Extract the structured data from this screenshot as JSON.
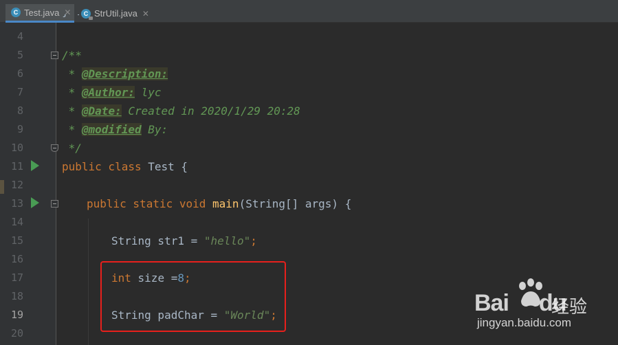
{
  "tabs": [
    {
      "label": "Test.java",
      "icon": "java-class-icon",
      "active": true
    },
    {
      "label": "StrUtil.java",
      "icon": "java-class-locked-icon",
      "active": false
    }
  ],
  "lines": [
    {
      "num": "4",
      "text": ""
    },
    {
      "num": "5",
      "text": "/**"
    },
    {
      "num": "6",
      "prefix": " * ",
      "tag": "@Description:",
      "rest": ""
    },
    {
      "num": "7",
      "prefix": " * ",
      "tag": "@Author:",
      "rest": " lyc"
    },
    {
      "num": "8",
      "prefix": " * ",
      "tag": "@Date:",
      "rest": " Created in 2020/1/29 20:28"
    },
    {
      "num": "9",
      "prefix": " * ",
      "tag": "@modified",
      "rest": " By:"
    },
    {
      "num": "10",
      "text": " */"
    },
    {
      "num": "11",
      "kw": "public class",
      "rest": " Test {"
    },
    {
      "num": "12",
      "text": ""
    },
    {
      "num": "13",
      "kw": "public static void",
      "fn": "main",
      "rest": "(String[] args) {"
    },
    {
      "num": "14",
      "text": ""
    },
    {
      "num": "15",
      "type": "String",
      "var": " str1 = ",
      "str": "\"hello\"",
      "end": ";"
    },
    {
      "num": "16",
      "text": ""
    },
    {
      "num": "17",
      "kw": "int",
      "var": " size =",
      "num_val": "8",
      "end": ";"
    },
    {
      "num": "18",
      "text": ""
    },
    {
      "num": "19",
      "type": "String",
      "var": " padChar = ",
      "str": "\"World\"",
      "end": ";"
    },
    {
      "num": "20",
      "text": ""
    }
  ],
  "watermark": {
    "logo": "Bai",
    "logo_end": "du",
    "cn": "经验",
    "url": "jingyan.baidu.com"
  },
  "colors": {
    "highlight_box": "#e8201c",
    "keyword": "#cc7832",
    "string": "#6a8759",
    "number": "#6897bb",
    "doc_comment": "#629755"
  }
}
